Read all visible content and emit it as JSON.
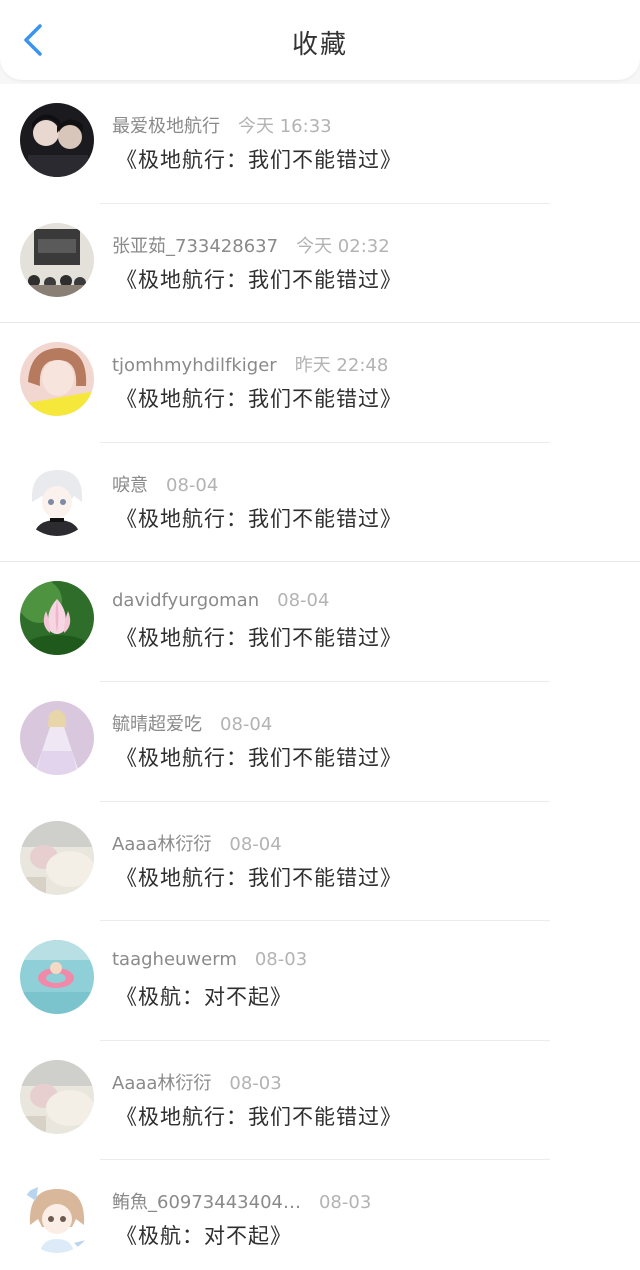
{
  "header": {
    "title": "收藏"
  },
  "favorites": [
    {
      "name": "最爱极地航行",
      "time": "今天 16:33",
      "content": "《极地航行：我们不能错过》",
      "avatar_icon": "avatar-couple-photo"
    },
    {
      "name": "张亚茹_733428637",
      "time": "今天 02:32",
      "content": "《极地航行：我们不能错过》",
      "avatar_icon": "avatar-exo-album"
    },
    {
      "name": "tjomhmyhdilfkiger",
      "time": "昨天 22:48",
      "content": "《极地航行：我们不能错过》",
      "avatar_icon": "avatar-girl-selfie"
    },
    {
      "name": "唳意",
      "time": "08-04",
      "content": "《极地航行：我们不能错过》",
      "avatar_icon": "avatar-anime-boy"
    },
    {
      "name": "davidfyurgoman",
      "time": "08-04",
      "content": "《极地航行：我们不能错过》",
      "avatar_icon": "avatar-lotus-flower"
    },
    {
      "name": "毓晴超爱吃",
      "time": "08-04",
      "content": "《极地航行：我们不能错过》",
      "avatar_icon": "avatar-princess-doll"
    },
    {
      "name": "Aaaa林衍衍",
      "time": "08-04",
      "content": "《极地航行：我们不能错过》",
      "avatar_icon": "avatar-plush-toy"
    },
    {
      "name": "taagheuwerm",
      "time": "08-03",
      "content": "《极航：对不起》",
      "avatar_icon": "avatar-swimming-pool"
    },
    {
      "name": "Aaaa林衍衍",
      "time": "08-03",
      "content": "《极地航行：我们不能错过》",
      "avatar_icon": "avatar-plush-toy"
    },
    {
      "name": "鲔魚_60973443404…",
      "time": "08-03",
      "content": "《极航：对不起》",
      "avatar_icon": "avatar-anime-girl"
    }
  ],
  "colors": {
    "accent_back_arrow": "#3a93f0",
    "name_text": "#8a8a8a",
    "time_text": "#b3b3b3",
    "content_text": "#2f2f2f"
  }
}
